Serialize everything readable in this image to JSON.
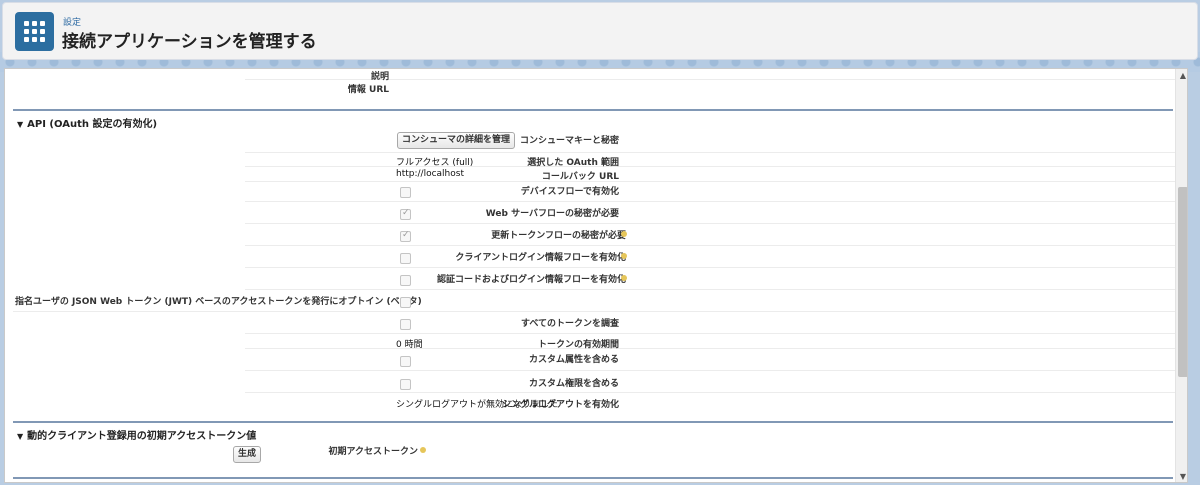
{
  "header": {
    "breadcrumb": "設定",
    "title": "接続アプリケーションを管理する",
    "icon": "app-grid-icon"
  },
  "top_fields": {
    "description_label": "説明",
    "info_url_label": "情報 URL"
  },
  "api_section": {
    "title": "API (OAuth 設定の有効化)",
    "consumer_key_label": "コンシューマキーと秘密",
    "consumer_button": "コンシューマの詳細を管理",
    "oauth_scope_label": "選択した OAuth 範囲",
    "oauth_scope_value": "フルアクセス (full)",
    "callback_label": "コールバック URL",
    "callback_value": "http://localhost",
    "device_flow_label": "デバイスフローで有効化",
    "web_server_secret_label": "Web サーバフローの秘密が必要",
    "refresh_secret_label": "更新トークンフローの秘密が必要",
    "client_login_label": "クライアントログイン情報フローを有効化",
    "auth_code_label": "認証コードおよびログイン情報フローを有効化",
    "jwt_label": "指名ユーザの JSON Web トークン (JWT) ベースのアクセストークンを発行にオプトイン (ベータ)",
    "introspect_label": "すべてのトークンを調査",
    "token_validity_label": "トークンの有効期間",
    "token_validity_value": "0 時間",
    "custom_attr_label": "カスタム属性を含める",
    "custom_perm_label": "カスタム権限を含める",
    "single_logout_label": "シングルログアウトを有効化",
    "single_logout_value": "シングルログアウトが無効になりました"
  },
  "dynamic_section": {
    "title": "動的クライアント登録用の初期アクセストークン値",
    "initial_token_label": "初期アクセストークン",
    "generate_button": "生成"
  },
  "checkbox_states": {
    "device_flow": false,
    "web_server_secret": true,
    "refresh_secret": true,
    "client_login": false,
    "auth_code": false,
    "jwt": false,
    "introspect": false,
    "custom_attr": false,
    "custom_perm": false
  },
  "colors": {
    "accent": "#2c6ea0",
    "link": "#2e6ba3",
    "section_rule": "#8198b5"
  }
}
